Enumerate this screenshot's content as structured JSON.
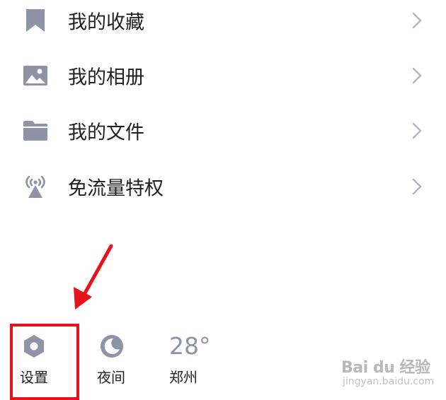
{
  "menu": {
    "items": [
      {
        "label": "我的收藏",
        "icon": "bookmark-icon"
      },
      {
        "label": "我的相册",
        "icon": "image-icon"
      },
      {
        "label": "我的文件",
        "icon": "folder-icon"
      },
      {
        "label": "免流量特权",
        "icon": "signal-tower-icon"
      }
    ]
  },
  "bottom_bar": {
    "settings_label": "设置",
    "night_label": "夜间",
    "temperature": "28°",
    "city": "郑州"
  },
  "watermark": {
    "text": "Bai du 经验",
    "sub": "jingyan.baidu.com"
  },
  "colors": {
    "icon_gray": "#8e93a6",
    "highlight_red": "#e8131a",
    "text": "#202020",
    "chevron": "#b5b8c2"
  }
}
